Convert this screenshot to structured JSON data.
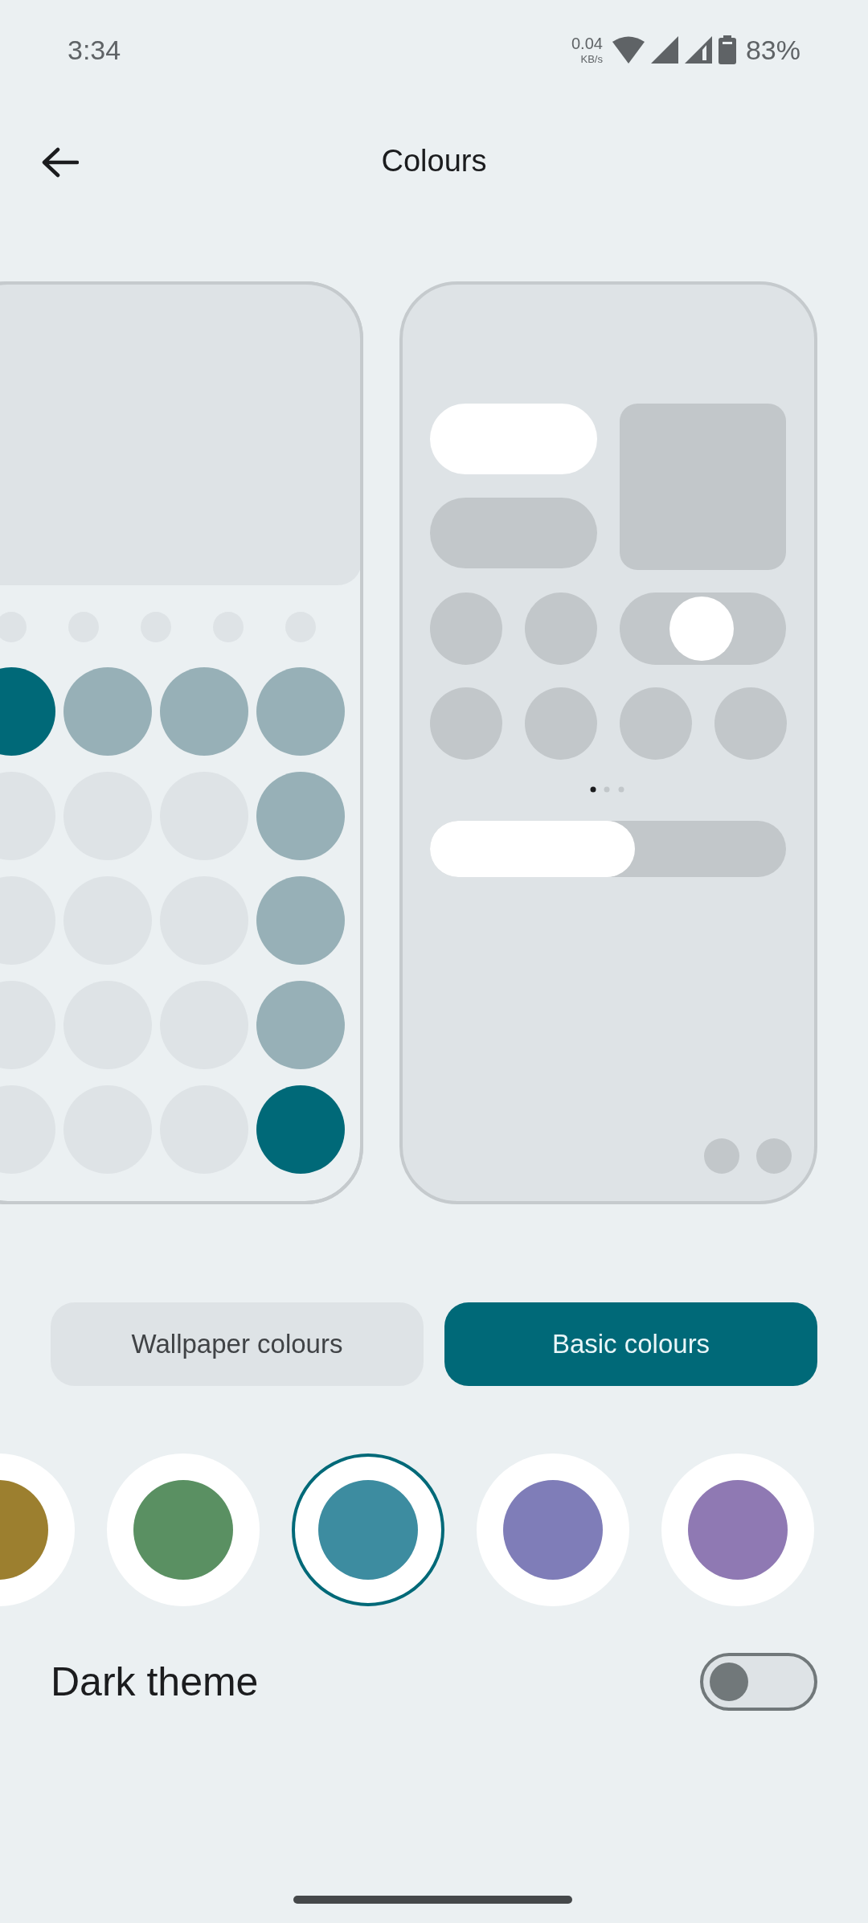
{
  "status_bar": {
    "time": "3:34",
    "net_speed": "0.04",
    "net_unit": "KB/s",
    "battery": "83%"
  },
  "header": {
    "title": "Colours"
  },
  "tabs": [
    {
      "label": "Wallpaper colours",
      "selected": false
    },
    {
      "label": "Basic colours",
      "selected": true
    }
  ],
  "swatches": [
    {
      "color": "#9c7f2f",
      "selected": false
    },
    {
      "color": "#5a9062",
      "selected": false
    },
    {
      "color": "#3d8ca0",
      "selected": true
    },
    {
      "color": "#7f7db8",
      "selected": false
    },
    {
      "color": "#8f79b3",
      "selected": false
    }
  ],
  "dark_theme": {
    "label": "Dark theme",
    "on": false
  }
}
